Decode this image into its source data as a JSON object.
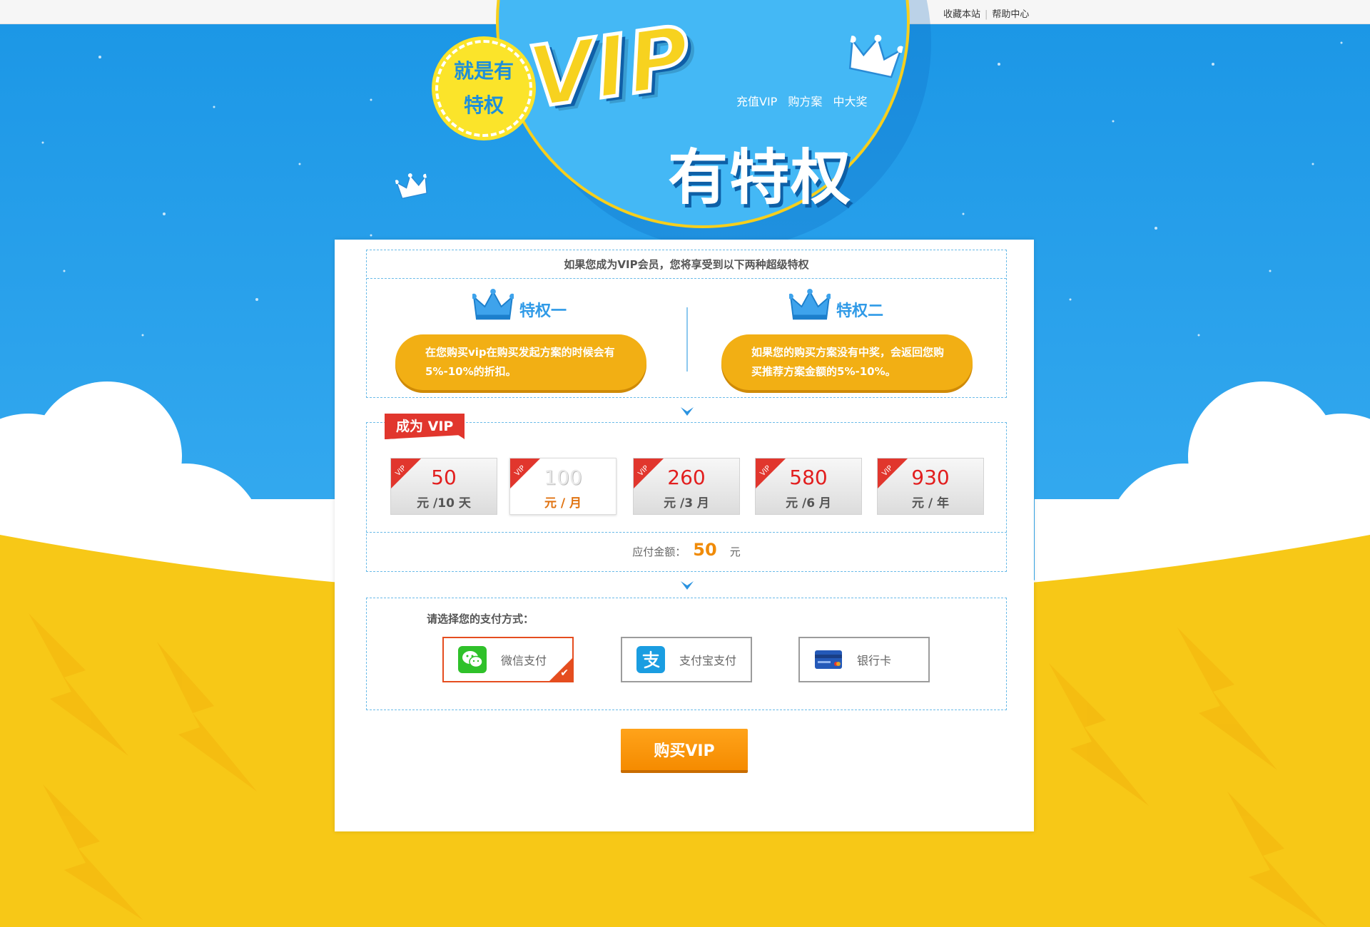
{
  "topbar": {
    "bookmark_label": "收藏本站",
    "help_label": "帮助中心"
  },
  "hero": {
    "badge_line1": "就是有",
    "badge_line2": "特权",
    "vip_text": "VIP",
    "slogan": [
      "充值VIP",
      "购方案",
      "中大奖"
    ],
    "privilege_text": "有特权"
  },
  "intro": {
    "title": "如果您成为VIP会员，您将享受到以下两种超级特权",
    "privileges": [
      {
        "title": "特权一",
        "desc": "在您购买vip在购买发起方案的时候会有5%-10%的折扣。"
      },
      {
        "title": "特权二",
        "desc": "如果您的购买方案没有中奖，会返回您购买推荐方案金额的5%-10%。"
      }
    ]
  },
  "become_vip": {
    "ribbon": "成为 VIP",
    "tag_text": "VIP",
    "plans": [
      {
        "price": "50",
        "unit": "元 /10 天",
        "selected": false
      },
      {
        "price": "100",
        "unit": "元 / 月",
        "selected": true
      },
      {
        "price": "260",
        "unit": "元 /3 月",
        "selected": false
      },
      {
        "price": "580",
        "unit": "元 /6 月",
        "selected": false
      },
      {
        "price": "930",
        "unit": "元 / 年",
        "selected": false
      }
    ],
    "amount_label": "应付金额：",
    "amount_value": "50",
    "amount_unit": "元"
  },
  "payment": {
    "title": "请选择您的支付方式：",
    "options": [
      {
        "label": "微信支付",
        "icon": "wechat-icon",
        "selected": true
      },
      {
        "label": "支付宝支付",
        "icon": "alipay-icon",
        "selected": false
      },
      {
        "label": "银行卡",
        "icon": "bank-card-icon",
        "selected": false
      }
    ]
  },
  "buy_button": "购买VIP",
  "colors": {
    "sky": "#1c97e6",
    "accent_orange": "#f2af14",
    "ribbon_red": "#e1362d",
    "selected_border": "#e54d1f",
    "yellow_bottom": "#f7c817"
  }
}
